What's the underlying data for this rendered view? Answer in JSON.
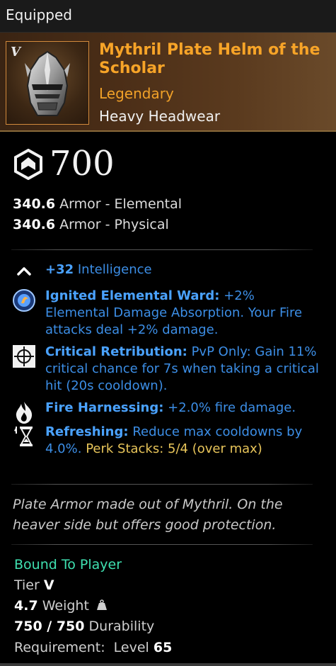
{
  "header": {
    "title": "Equipped"
  },
  "item": {
    "tier_badge": "V",
    "name": "Mythril Plate Helm of the Scholar",
    "rarity": "Legendary",
    "type": "Heavy Headwear",
    "gear_score": "700"
  },
  "armor": [
    {
      "value": "340.6",
      "label": "Armor - Elemental"
    },
    {
      "value": "340.6",
      "label": "Armor - Physical"
    }
  ],
  "attribute": {
    "value": "+32",
    "label": "Intelligence"
  },
  "perks": [
    {
      "name": "Ignited Elemental Ward:",
      "desc": " +2% Elemental Damage Absorption. Your Fire attacks deal +2% damage."
    },
    {
      "name": "Critical Retribution:",
      "desc": " PvP Only: Gain 11% critical chance for 7s when taking a critical hit (20s cooldown)."
    },
    {
      "name": "Fire Harnessing:",
      "desc": " +2.0% fire damage."
    },
    {
      "name": "Refreshing:",
      "desc": " Reduce max cooldowns by 4.0%.",
      "stacks": "Perk Stacks:  5/4 (over max)"
    }
  ],
  "flavor_text": "Plate Armor made out of Mythril. On the heaver side but offers good protection.",
  "bind_status": "Bound To Player",
  "tier": {
    "label": "Tier",
    "value": "V"
  },
  "weight": {
    "value": "4.7",
    "label": "Weight"
  },
  "durability": {
    "value": "750 / 750",
    "label": "Durability"
  },
  "requirement": {
    "label": "Requirement:  Level",
    "value": "65"
  },
  "colors": {
    "legendary": "#f7a428",
    "perk_blue": "#4aa2ff",
    "bound_green": "#3fe0b0",
    "stack_gold": "#e8c55a"
  }
}
